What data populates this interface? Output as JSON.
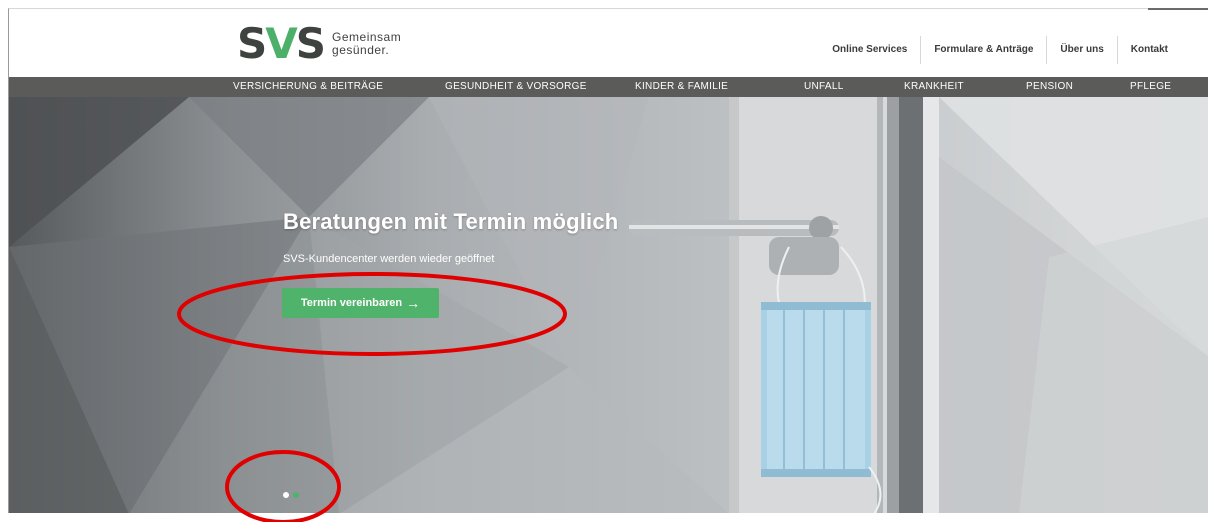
{
  "logo": {
    "mark_s1": "S",
    "mark_v": "V",
    "mark_s2": "S",
    "tagline_line1": "Gemeinsam",
    "tagline_line2": "gesünder."
  },
  "topnav": {
    "items": [
      {
        "label": "Online Services"
      },
      {
        "label": "Formulare & Anträge"
      },
      {
        "label": "Über uns"
      },
      {
        "label": "Kontakt"
      }
    ]
  },
  "mainnav": {
    "items": [
      {
        "label": "VERSICHERUNG & BEITRÄGE"
      },
      {
        "label": "GESUNDHEIT & VORSORGE"
      },
      {
        "label": "KINDER & FAMILIE"
      },
      {
        "label": "UNFALL"
      },
      {
        "label": "KRANKHEIT"
      },
      {
        "label": "PENSION"
      },
      {
        "label": "PFLEGE"
      }
    ]
  },
  "hero": {
    "title": "Beratungen mit Termin möglich",
    "subtitle": "SVS-Kundencenter werden wieder geöffnet",
    "button_label": "Termin vereinbaren",
    "button_icon": "arrow-right-icon",
    "carousel": {
      "total": 2,
      "active_index": 1
    }
  },
  "colors": {
    "brand_green": "#4fb36b",
    "nav_bg": "#5b5b59",
    "text_dark": "#3f4340",
    "annotation_red": "#e00000"
  }
}
